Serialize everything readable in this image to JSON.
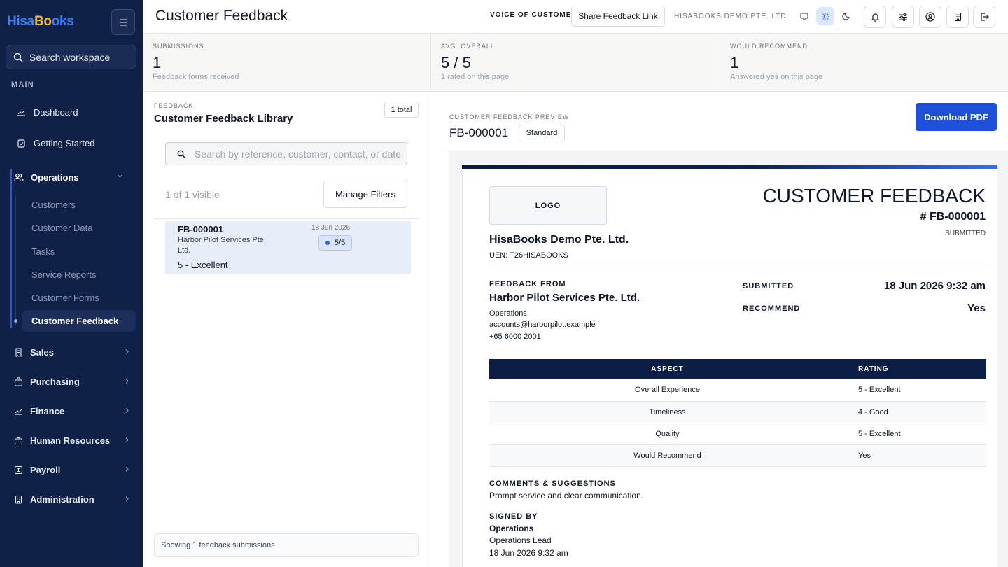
{
  "sidebar": {
    "brand": {
      "part1": "Hisa",
      "part2": "Bo",
      "part3": "oks"
    },
    "search_label": "Search workspace",
    "section_main": "MAIN",
    "top_items": [
      {
        "label": "Dashboard",
        "icon": "chart-line-icon"
      },
      {
        "label": "Getting Started",
        "icon": "clipboard-check-icon"
      }
    ],
    "operations": {
      "label": "Operations",
      "icon": "users-icon",
      "children": [
        "Customers",
        "Customer Data",
        "Tasks",
        "Service Reports",
        "Customer Forms",
        "Customer Feedback"
      ],
      "active": "Customer Feedback"
    },
    "groups": [
      {
        "label": "Sales",
        "icon": "receipt-icon"
      },
      {
        "label": "Purchasing",
        "icon": "bag-icon"
      },
      {
        "label": "Finance",
        "icon": "chart-line-icon"
      },
      {
        "label": "Human Resources",
        "icon": "briefcase-icon"
      },
      {
        "label": "Payroll",
        "icon": "dollar-icon"
      },
      {
        "label": "Administration",
        "icon": "building-icon"
      }
    ]
  },
  "header": {
    "title": "Customer Feedback",
    "voice_label": "VOICE OF CUSTOMER",
    "share_button": "Share Feedback Link",
    "company": "HISABOOKS DEMO PTE. LTD.",
    "theme_modes": [
      "monitor-icon",
      "sun-icon",
      "moon-icon"
    ],
    "active_mode": "sun-icon",
    "icons": [
      "bell-icon",
      "sliders-icon",
      "user-circle-icon",
      "building-icon",
      "logout-icon"
    ]
  },
  "stats": [
    {
      "label": "SUBMISSIONS",
      "value": "1",
      "sub": "Feedback forms received"
    },
    {
      "label": "AVG. OVERALL",
      "value": "5 / 5",
      "sub": "1 rated on this page"
    },
    {
      "label": "WOULD RECOMMEND",
      "value": "1",
      "sub": "Answered yes on this page"
    }
  ],
  "library": {
    "label": "FEEDBACK",
    "title": "Customer Feedback Library",
    "total": "1 total",
    "search_placeholder": "Search by reference, customer, contact, or date",
    "visible": "1 of 1 visible",
    "manage_filters": "Manage Filters",
    "rows": [
      {
        "ref": "FB-000001",
        "customer": "Harbor Pilot Services Pte. Ltd.",
        "date": "18 Jun 2026",
        "score": "5/5",
        "rating": "5 - Excellent"
      }
    ],
    "footer": "Showing 1 feedback submissions"
  },
  "preview": {
    "label": "CUSTOMER FEEDBACK PREVIEW",
    "ref": "FB-000001",
    "template": "Standard",
    "download": "Download PDF"
  },
  "document": {
    "logo": "LOGO",
    "title": "CUSTOMER FEEDBACK",
    "number": "# FB-000001",
    "status": "SUBMITTED",
    "company": "HisaBooks Demo Pte. Ltd.",
    "uen": "UEN: T26HISABOOKS",
    "from_label": "FEEDBACK FROM",
    "from_name": "Harbor Pilot Services Pte. Ltd.",
    "from_lines": [
      "Operations",
      "accounts@harborpilot.example",
      "+65 6000 2001"
    ],
    "submitted_label": "SUBMITTED",
    "submitted_value": "18 Jun 2026 9:32 am",
    "recommend_label": "RECOMMEND",
    "recommend_value": "Yes",
    "table_headers": [
      "ASPECT",
      "RATING"
    ],
    "table_rows": [
      {
        "aspect": "Overall Experience",
        "rating": "5 - Excellent"
      },
      {
        "aspect": "Timeliness",
        "rating": "4 - Good"
      },
      {
        "aspect": "Quality",
        "rating": "5 - Excellent"
      },
      {
        "aspect": "Would Recommend",
        "rating": "Yes"
      }
    ],
    "comments_label": "COMMENTS & SUGGESTIONS",
    "comments": "Prompt service and clear communication.",
    "signed_label": "SIGNED BY",
    "signed_name": "Operations",
    "signed_role": "Operations Lead",
    "signed_date": "18 Jun 2026 9:32 am"
  },
  "colors": {
    "sidebar_bg": "#0f2147",
    "accent": "#1d4fd8",
    "doc_header": "#0c1e45"
  }
}
